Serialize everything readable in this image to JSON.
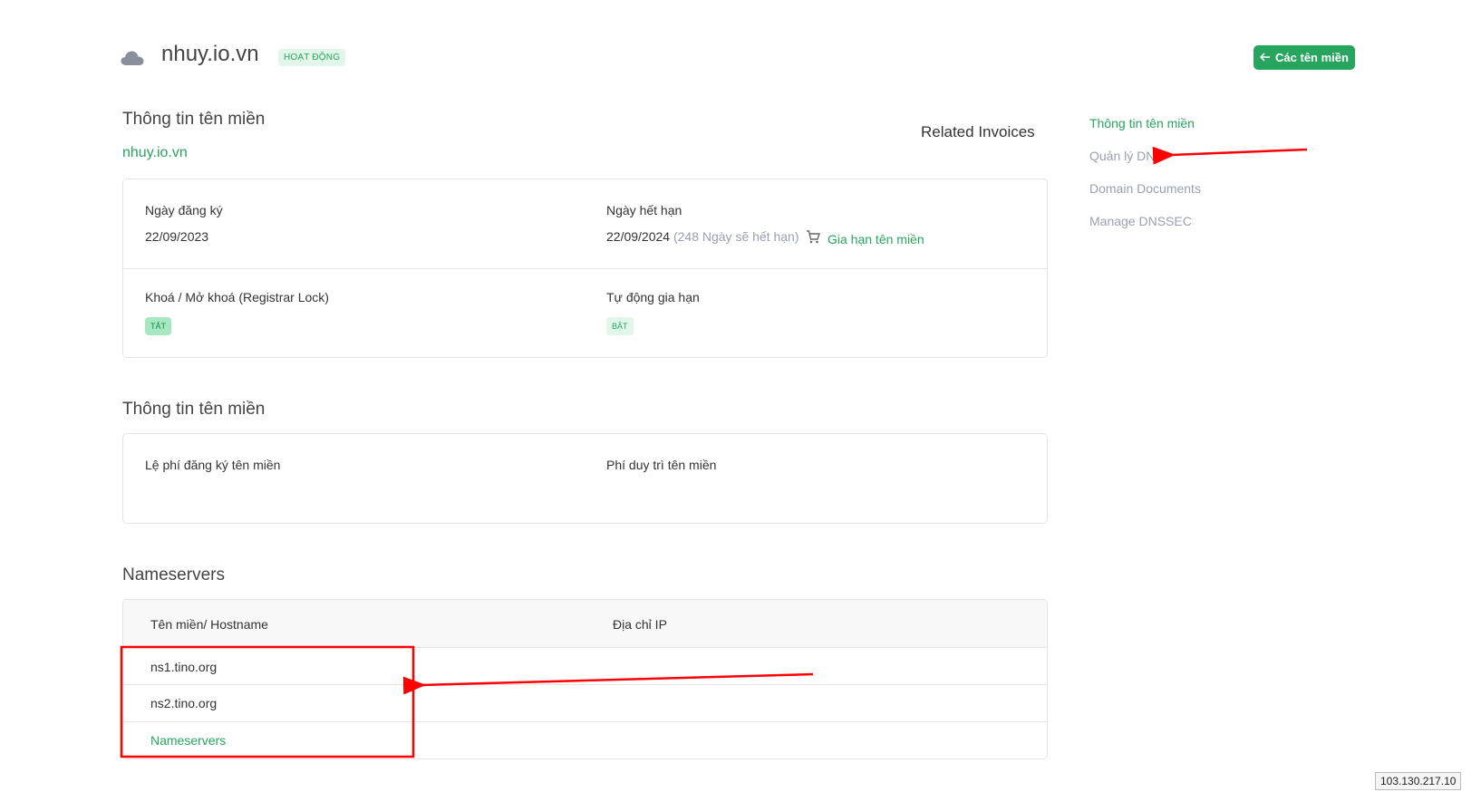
{
  "header": {
    "domain_name": "nhuy.io.vn",
    "status": "HOẠT ĐỘNG",
    "back_button_label": "Các tên miền"
  },
  "domain_info": {
    "title": "Thông tin tên miền",
    "domain_link": "nhuy.io.vn",
    "related_invoices": "Related Invoices",
    "registration_label": "Ngày đăng ký",
    "registration_date": "22/09/2023",
    "expiry_label": "Ngày hết hạn",
    "expiry_date": "22/09/2024",
    "expiry_remaining": "(248 Ngày sẽ hết hạn)",
    "renew_link": "Gia hạn tên miền",
    "lock_label": "Khoá / Mở khoá (Registrar Lock)",
    "lock_status": "TẮT",
    "auto_renew_label": "Tự động gia hạn",
    "auto_renew_status": "BẬT"
  },
  "fees": {
    "title": "Thông tin tên miền",
    "registration_fee_label": "Lệ phí đăng ký tên miền",
    "maintenance_fee_label": "Phí duy trì tên miền"
  },
  "nameservers": {
    "title": "Nameservers",
    "col_hostname": "Tên miền/ Hostname",
    "col_ip": "Địa chỉ IP",
    "rows": [
      {
        "hostname": "ns1.tino.org"
      },
      {
        "hostname": "ns2.tino.org"
      }
    ],
    "link": "Nameservers"
  },
  "sidebar": {
    "items": [
      {
        "label": "Thông tin tên miền"
      },
      {
        "label": "Quản lý DNS"
      },
      {
        "label": "Domain Documents"
      },
      {
        "label": "Manage DNSSEC"
      }
    ]
  },
  "footer": {
    "ip": "103.130.217.10"
  },
  "colors": {
    "accent": "#27a55f",
    "annotation": "#ff0000"
  }
}
